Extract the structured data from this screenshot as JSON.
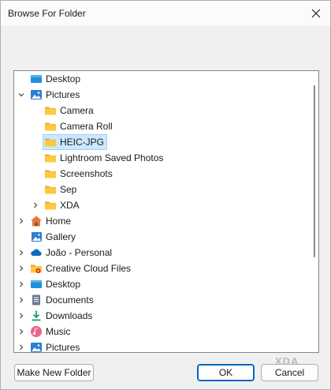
{
  "window": {
    "title": "Browse For Folder"
  },
  "tree": {
    "items": [
      {
        "label": "Desktop",
        "icon": "desktop-icon",
        "expander": "none",
        "level": 0
      },
      {
        "label": "Pictures",
        "icon": "pictures-icon",
        "expander": "expanded",
        "level": 0
      },
      {
        "label": "Camera",
        "icon": "folder-icon",
        "expander": "none",
        "level": 1
      },
      {
        "label": "Camera Roll",
        "icon": "folder-icon",
        "expander": "none",
        "level": 1
      },
      {
        "label": "HEIC-JPG",
        "icon": "folder-icon",
        "expander": "none",
        "level": 1,
        "selected": true
      },
      {
        "label": "Lightroom Saved Photos",
        "icon": "folder-icon",
        "expander": "none",
        "level": 1
      },
      {
        "label": "Screenshots",
        "icon": "folder-icon",
        "expander": "none",
        "level": 1
      },
      {
        "label": "Sep",
        "icon": "folder-icon",
        "expander": "none",
        "level": 1
      },
      {
        "label": "XDA",
        "icon": "folder-icon",
        "expander": "collapsed",
        "level": 1
      },
      {
        "label": "Home",
        "icon": "home-icon",
        "expander": "collapsed",
        "level": 0
      },
      {
        "label": "Gallery",
        "icon": "gallery-icon",
        "expander": "none",
        "level": 0
      },
      {
        "label": "João - Personal",
        "icon": "onedrive-icon",
        "expander": "collapsed",
        "level": 0
      },
      {
        "label": "Creative Cloud Files",
        "icon": "creative-cloud-icon",
        "expander": "collapsed",
        "level": 0
      },
      {
        "label": "Desktop",
        "icon": "desktop-icon",
        "expander": "collapsed",
        "level": 0
      },
      {
        "label": "Documents",
        "icon": "documents-icon",
        "expander": "collapsed",
        "level": 0
      },
      {
        "label": "Downloads",
        "icon": "downloads-icon",
        "expander": "collapsed",
        "level": 0
      },
      {
        "label": "Music",
        "icon": "music-icon",
        "expander": "collapsed",
        "level": 0
      },
      {
        "label": "Pictures",
        "icon": "pictures-icon",
        "expander": "collapsed",
        "level": 0
      }
    ]
  },
  "buttons": {
    "new_folder": "Make New Folder",
    "ok": "OK",
    "cancel": "Cancel"
  },
  "watermark": "XDA",
  "colors": {
    "selection": "#cce8ff",
    "selection_border": "#99d1ff",
    "folder": "#ffc83d",
    "accent": "#0067c0"
  }
}
